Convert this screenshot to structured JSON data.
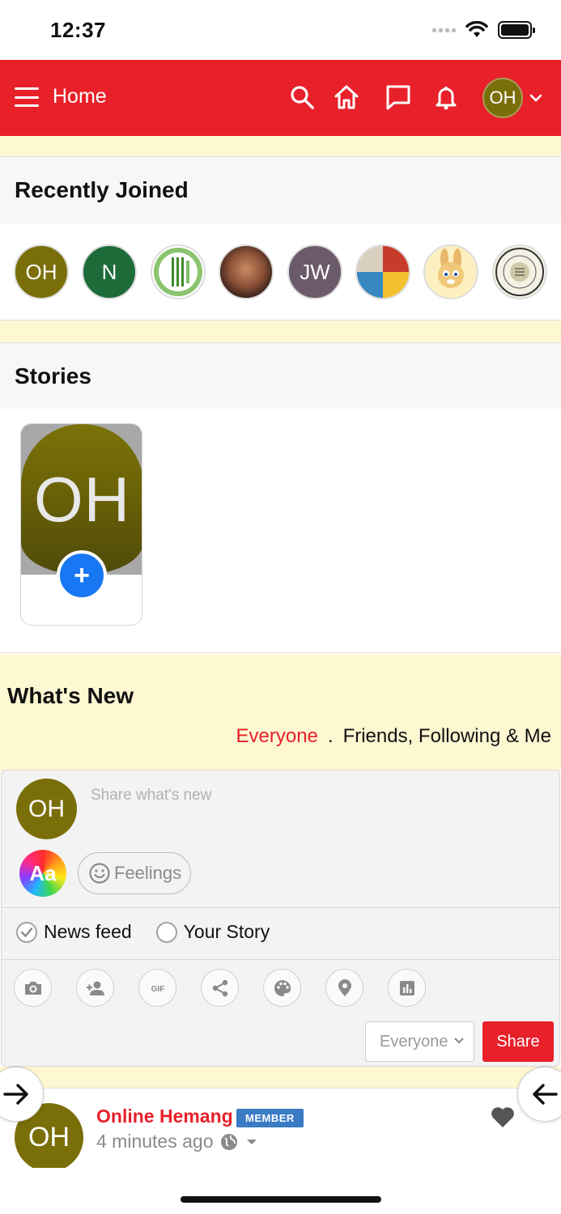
{
  "status_bar": {
    "time": "12:37"
  },
  "header": {
    "title": "Home",
    "avatar_initials": "OH",
    "brand_color": "#e8202a"
  },
  "recently_joined": {
    "title": "Recently Joined",
    "members": [
      {
        "initials": "OH",
        "color": "#7a6e08",
        "kind": "initials"
      },
      {
        "initials": "N",
        "color": "#1e6b3a",
        "kind": "initials"
      },
      {
        "initials": "",
        "color": "#7fbf6a",
        "kind": "fork-knife-logo"
      },
      {
        "initials": "",
        "color": "#5a3b2a",
        "kind": "photo"
      },
      {
        "initials": "JW",
        "color": "#6b5a6a",
        "kind": "initials"
      },
      {
        "initials": "",
        "color": "#c73b2a",
        "kind": "collage"
      },
      {
        "initials": "",
        "color": "#fdf0c0",
        "kind": "bunny-cartoon"
      },
      {
        "initials": "",
        "color": "#f0f0e0",
        "kind": "bunny-seal"
      }
    ]
  },
  "stories": {
    "title": "Stories",
    "own_story_initials": "OH",
    "add_label": "+"
  },
  "whats_new": {
    "title": "What's New",
    "filter_active": "Everyone",
    "filter_separator": ".",
    "filter_other": "Friends, Following & Me"
  },
  "composer": {
    "avatar_initials": "OH",
    "placeholder": "Share what's new",
    "text_style_label": "Aa",
    "feelings_label": "Feelings",
    "targets": [
      {
        "label": "News feed",
        "checked": true
      },
      {
        "label": "Your Story",
        "checked": false
      }
    ],
    "tools": [
      "camera-icon",
      "add-person-icon",
      "gif-icon",
      "share-icon",
      "palette-icon",
      "location-icon",
      "poll-icon"
    ],
    "privacy_value": "Everyone",
    "share_label": "Share"
  },
  "post": {
    "avatar_initials": "OH",
    "author": "Online Hemang",
    "badge": "MEMBER",
    "time": "4 minutes ago"
  }
}
